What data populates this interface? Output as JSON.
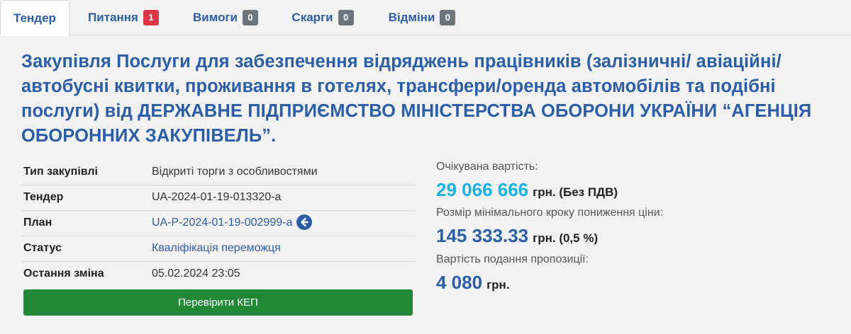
{
  "tabs": [
    {
      "label": "Тендер",
      "badge": null
    },
    {
      "label": "Питання",
      "badge": "1"
    },
    {
      "label": "Вимоги",
      "badge": "0"
    },
    {
      "label": "Скарги",
      "badge": "0"
    },
    {
      "label": "Відміни",
      "badge": "0"
    }
  ],
  "title": "Закупівля Послуги для забезпечення відряджень працівників (залізничні/ авіаційні/ автобусні квитки, проживання в готелях, трансфери/оренда автомобілів та подібні послуги) від ДЕРЖАВНЕ ПІДПРИЄМСТВО МІНІСТЕРСТВА ОБОРОНИ УКРАЇНИ “АГЕНЦІЯ ОБОРОННИХ ЗАКУПІВЕЛЬ”.",
  "info": {
    "type_label": "Тип закупівлі",
    "type_value": "Відкриті торги з особливостями",
    "tender_label": "Тендер",
    "tender_value": "UA-2024-01-19-013320-a",
    "plan_label": "План",
    "plan_value": "UA-P-2024-01-19-002999-a",
    "status_label": "Статус",
    "status_value": "Кваліфікація переможця",
    "changed_label": "Остання зміна",
    "changed_value": "05.02.2024 23:05"
  },
  "verify_button": "Перевірити КЕП",
  "costs": {
    "expected_label": "Очікувана вартість:",
    "expected_value": "29 066 666",
    "expected_unit": "грн. (Без ПДВ)",
    "step_label": "Розмір мінімального кроку пониження ціни:",
    "step_value": "145 333.33",
    "step_unit": "грн. (0,5 %)",
    "fee_label": "Вартість подання пропозиції:",
    "fee_value": "4 080",
    "fee_unit": "грн."
  },
  "colors": {
    "accent": "#2b5ea7",
    "expected_value": "#1ab1e0",
    "button": "#218838",
    "badge_red": "#dc3545",
    "badge_gray": "#6c757d"
  },
  "icons": {
    "plan_link": "arrow-left-circle-icon"
  }
}
